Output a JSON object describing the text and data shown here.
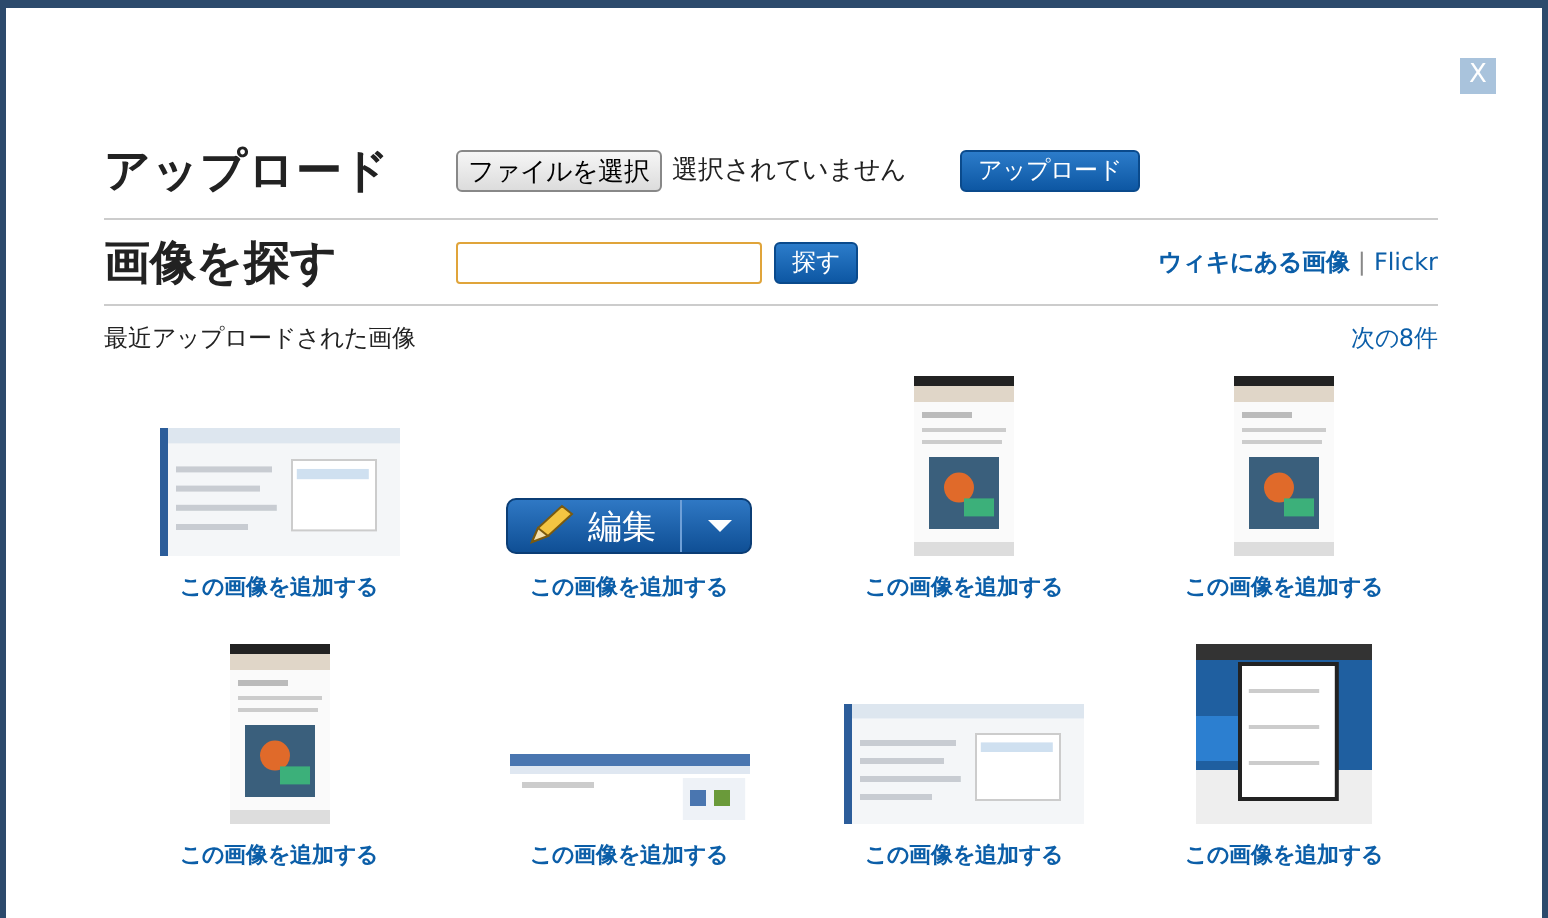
{
  "close_button": "X",
  "upload": {
    "heading": "アップロード",
    "file_button": "ファイルを選択",
    "file_status": "選択されていません",
    "submit_button": "アップロード"
  },
  "search": {
    "heading": "画像を探す",
    "submit_button": "探す",
    "sources": [
      {
        "label": "ウィキにある画像",
        "selected": true
      },
      {
        "label": "Flickr",
        "selected": false
      }
    ],
    "separator": "|"
  },
  "recent": {
    "title": "最近アップロードされた画像",
    "next_link": "次の8件"
  },
  "images": [
    {
      "kind": "picture",
      "caption": "この画像を追加する"
    },
    {
      "kind": "edit-button",
      "label": "編集",
      "caption": "この画像を追加する"
    },
    {
      "kind": "picture",
      "caption": "この画像を追加する"
    },
    {
      "kind": "picture",
      "caption": "この画像を追加する"
    },
    {
      "kind": "picture",
      "caption": "この画像を追加する"
    },
    {
      "kind": "picture",
      "caption": "この画像を追加する"
    },
    {
      "kind": "picture",
      "caption": "この画像を追加する"
    },
    {
      "kind": "picture",
      "caption": "この画像を追加する"
    }
  ]
}
